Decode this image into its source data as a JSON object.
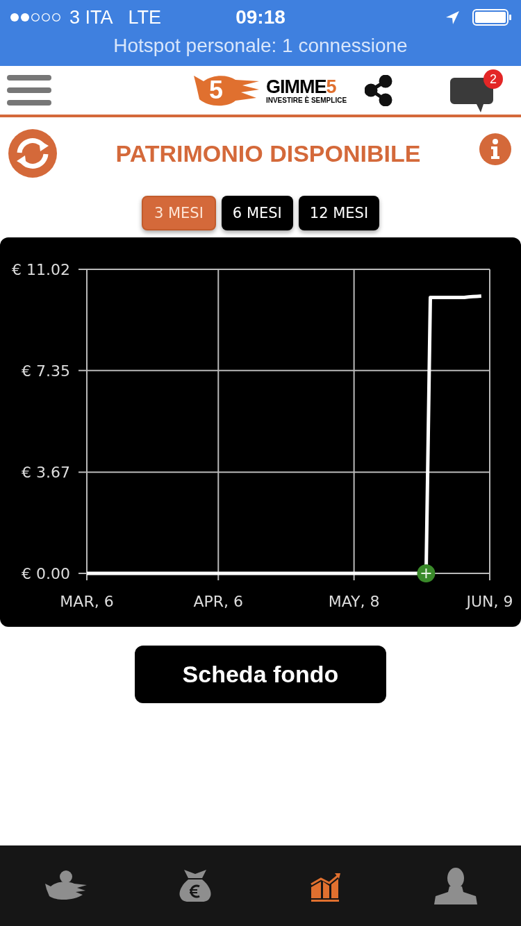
{
  "status_bar": {
    "carrier": "3 ITA",
    "network": "LTE",
    "time": "09:18"
  },
  "hotspot_banner": "Hotspot personale: 1 connessione",
  "header": {
    "logo_mark": "5",
    "logo_name": "GIMME",
    "logo_digit": "5",
    "tagline": "INVESTIRE È SEMPLICE",
    "notifications_badge": "2"
  },
  "title": "PATRIMONIO DISPONIBILE",
  "periods": [
    {
      "label": "3 MESI",
      "selected": true
    },
    {
      "label": "6 MESI",
      "selected": false
    },
    {
      "label": "12 MESI",
      "selected": false
    }
  ],
  "chart_data": {
    "type": "line",
    "categories": [
      "MAR, 6",
      null,
      null,
      null,
      null,
      null,
      null,
      null,
      null,
      null,
      null,
      null,
      null,
      null,
      null,
      null,
      null,
      null,
      null,
      null,
      null,
      null,
      null,
      null,
      null,
      null,
      null,
      null,
      null,
      null,
      null,
      "APR, 6",
      null,
      null,
      null,
      null,
      null,
      null,
      null,
      null,
      null,
      null,
      null,
      null,
      null,
      null,
      null,
      null,
      null,
      null,
      null,
      null,
      null,
      null,
      null,
      null,
      null,
      null,
      null,
      null,
      null,
      null,
      null,
      "MAY, 8",
      null,
      null,
      null,
      null,
      null,
      null,
      null,
      null,
      null,
      null,
      null,
      null,
      null,
      null,
      null,
      null,
      null,
      null,
      null,
      null,
      null,
      null,
      null,
      null,
      null,
      null,
      null,
      null,
      null,
      null,
      null,
      "JUN, 9"
    ],
    "series": [
      {
        "color": "#ffffff",
        "values": [
          0,
          0,
          0,
          0,
          0,
          0,
          0,
          0,
          0,
          0,
          0,
          0,
          0,
          0,
          0,
          0,
          0,
          0,
          0,
          0,
          0,
          0,
          0,
          0,
          0,
          0,
          0,
          0,
          0,
          0,
          0,
          0,
          0,
          0,
          0,
          0,
          0,
          0,
          0,
          0,
          0,
          0,
          0,
          0,
          0,
          0,
          0,
          0,
          0,
          0,
          0,
          0,
          0,
          0,
          0,
          0,
          0,
          0,
          0,
          0,
          0,
          0,
          0,
          0,
          0,
          0,
          0,
          0,
          0,
          0,
          0,
          0,
          0,
          0,
          0,
          0,
          0,
          0,
          0,
          0,
          0,
          10.0,
          10.0,
          10.0,
          10.0,
          10.0,
          10.0,
          10.0,
          10.0,
          10.0,
          10.02,
          10.03,
          10.04,
          10.05,
          null,
          null
        ]
      }
    ],
    "ylim": [
      0,
      11.02
    ],
    "grid": true,
    "yticks": [
      {
        "value": 0,
        "label": "€ 0.00"
      },
      {
        "value": 3.67,
        "label": "€ 3.67"
      },
      {
        "value": 7.35,
        "label": "€ 7.35"
      },
      {
        "value": 11.02,
        "label": "€ 11.02"
      }
    ]
  },
  "action_button": "Scheda fondo",
  "tab_bar": [
    {
      "kind": "piggy",
      "selected": false
    },
    {
      "kind": "moneybag",
      "selected": false
    },
    {
      "kind": "chart",
      "selected": true
    },
    {
      "kind": "user",
      "selected": false
    }
  ]
}
